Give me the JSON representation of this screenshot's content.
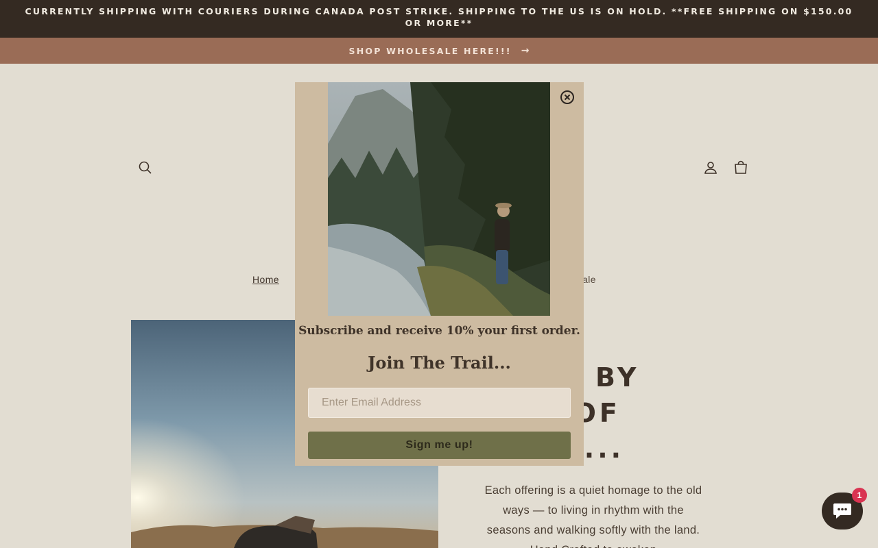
{
  "announcement": {
    "shipping_notice": "CURRENTLY SHIPPING WITH COURIERS DURING CANADA POST STRIKE. SHIPPING TO THE US IS ON HOLD. **FREE SHIPPING ON $150.00 OR MORE**",
    "wholesale_label": "SHOP WHOLESALE HERE!!!",
    "wholesale_arrow": "→"
  },
  "header": {
    "icons": [
      "search-icon",
      "account-icon",
      "cart-icon"
    ]
  },
  "breadcrumb": {
    "home": "Home",
    "current": "Wholesale"
  },
  "hero": {
    "headline": "…RED BY\n…S OF\n…LD...",
    "body": "Each offering is a quiet homage to the old ways — to living in rhythm with the seasons and walking softly with the land. Hand Crafted to awaken"
  },
  "popup": {
    "subtitle": "Subscribe and receive 10% your first order.",
    "title": "Join The Trail...",
    "email_value": "",
    "email_placeholder": "Enter Email Address",
    "button_label": "Sign me up!",
    "close_icon": "close-icon"
  },
  "chat": {
    "icon": "chat-icon",
    "badge_count": "1"
  },
  "colors": {
    "page_bg": "#e2ddd2",
    "topbar_bg": "#342a22",
    "wholesale_bg": "#9a6c56",
    "popup_bg": "#cdbba1",
    "button_bg": "#6f7049",
    "badge_bg": "#d93452"
  }
}
